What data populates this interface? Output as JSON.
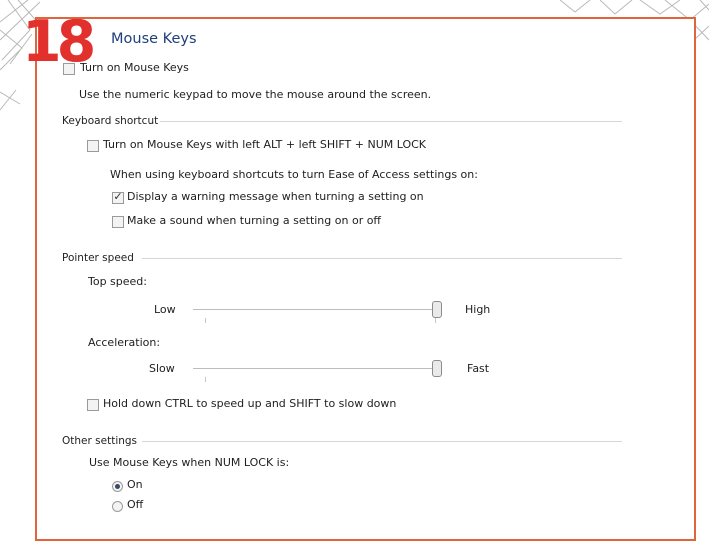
{
  "badge_number": "18",
  "title": "Mouse Keys",
  "turn_on": {
    "label": "Turn on Mouse Keys",
    "checked": false
  },
  "description": "Use the numeric keypad to move the mouse around the screen.",
  "keyboard_shortcut": {
    "header": "Keyboard shortcut",
    "toggle": {
      "label": "Turn on Mouse Keys with left ALT + left SHIFT + NUM LOCK",
      "checked": false
    },
    "note": "When using keyboard shortcuts to turn Ease of Access settings on:",
    "warning": {
      "label": "Display a warning message when turning a setting on",
      "checked": true
    },
    "sound": {
      "label": "Make a sound when turning a setting on or off",
      "checked": false
    }
  },
  "pointer_speed": {
    "header": "Pointer speed",
    "top_speed": {
      "label": "Top speed:",
      "min_label": "Low",
      "max_label": "High",
      "value": 0.98
    },
    "acceleration": {
      "label": "Acceleration:",
      "min_label": "Slow",
      "max_label": "Fast",
      "value": 0.98
    },
    "ctrl_shift": {
      "label": "Hold down CTRL to speed up and SHIFT to slow down",
      "checked": false
    }
  },
  "other_settings": {
    "header": "Other settings",
    "numlock_label": "Use Mouse Keys when NUM LOCK is:",
    "options": [
      {
        "label": "On",
        "selected": true
      },
      {
        "label": "Off",
        "selected": false
      }
    ]
  },
  "colors": {
    "accent": "#e0643c",
    "badge": "#e2302d",
    "title": "#1f3f7a"
  },
  "check_mark": "✓"
}
